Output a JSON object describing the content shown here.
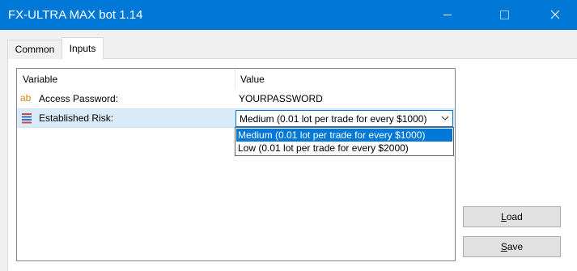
{
  "window": {
    "title": "FX-ULTRA MAX bot 1.14"
  },
  "tabs": [
    {
      "label": "Common"
    },
    {
      "label": "Inputs"
    }
  ],
  "grid": {
    "columns": [
      "Variable",
      "Value"
    ],
    "rows": [
      {
        "icon": "ab-text-icon",
        "icon_text": "ab",
        "variable": "Access Password:",
        "value": "YOURPASSWORD"
      },
      {
        "icon": "enum-list-icon",
        "variable": "Established Risk:",
        "value": "Medium (0.01 lot per trade for every $1000)"
      }
    ]
  },
  "dropdown": {
    "options": [
      "Medium (0.01 lot per trade for every $1000)",
      "Low (0.01 lot per trade for every $2000)"
    ],
    "selected_index": 0
  },
  "buttons": {
    "load": {
      "first": "L",
      "rest": "oad"
    },
    "save": {
      "first": "S",
      "rest": "ave"
    }
  },
  "colors": {
    "titlebar": "#0078d7",
    "selection": "#0078d7",
    "row_highlight": "#d9ebf9",
    "ab_icon": "#c88a12"
  }
}
